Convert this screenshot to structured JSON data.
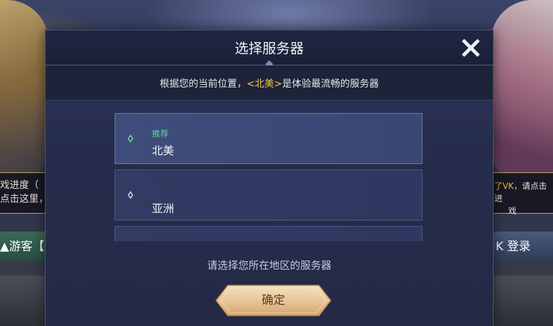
{
  "background": {
    "left_strip_line1": "戏进度（",
    "left_strip_line2": "点击这里，",
    "right_strip_prefix": "了VK，",
    "right_strip_text": "请点击进",
    "right_strip_line2": "戏",
    "left_button": "游客【",
    "right_button": "K 登录"
  },
  "dialog": {
    "title": "选择服务器",
    "hint_prefix": "根据您的当前位置，",
    "hint_highlight": "<北美>",
    "hint_suffix": "是体验最流畅的服务器",
    "servers": [
      {
        "tag": "推荐",
        "name": "北美",
        "selected": true
      },
      {
        "tag": "",
        "name": "亚洲",
        "selected": false
      }
    ],
    "prompt": "请选择您所在地区的服务器",
    "confirm_label": "确定"
  },
  "colors": {
    "accent_gold": "#f2c94c",
    "recommended_green": "#5fd6a0",
    "button_gold": "#e9c79a"
  }
}
